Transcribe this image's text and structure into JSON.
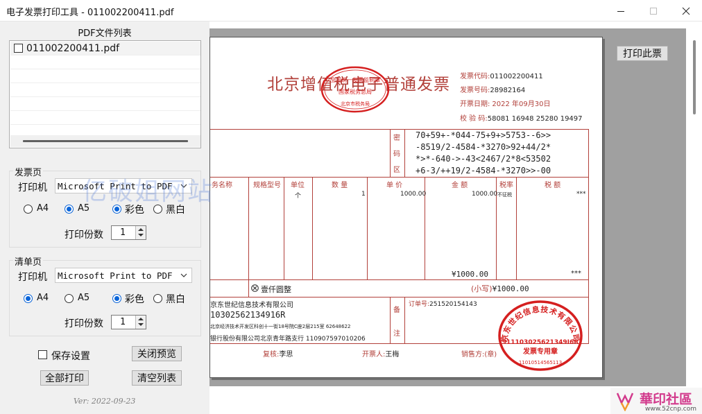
{
  "window": {
    "title": "电子发票打印工具  - 011002200411.pdf",
    "minimize_icon": "minimize-icon",
    "maximize_icon": "maximize-icon",
    "close_icon": "close-icon"
  },
  "pdf_list": {
    "title": "PDF文件列表",
    "items": [
      {
        "name": "011002200411.pdf",
        "checked": false
      }
    ]
  },
  "invoice_group": {
    "title": "发票页",
    "printer_label": "打印机",
    "printer_value": "Microsoft Print to PDF",
    "paper_options": [
      "A4",
      "A5"
    ],
    "paper_selected": "A5",
    "color_options": [
      "彩色",
      "黑白"
    ],
    "color_selected": "彩色",
    "copies_label": "打印份数",
    "copies_value": "1"
  },
  "detail_group": {
    "title": "清单页",
    "printer_label": "打印机",
    "printer_value": "Microsoft Print to PDF",
    "paper_options": [
      "A4",
      "A5"
    ],
    "paper_selected": "A4",
    "color_options": [
      "彩色",
      "黑白"
    ],
    "color_selected": "彩色",
    "copies_label": "打印份数",
    "copies_value": "1"
  },
  "actions": {
    "save_settings_label": "保存设置",
    "save_settings_checked": false,
    "close_preview_label": "关闭预览",
    "print_all_label": "全部打印",
    "clear_list_label": "清空列表",
    "print_this_label": "打印此票"
  },
  "version": "Ver: 2022-09-23",
  "watermark_text": "亿破姐网站",
  "invoice": {
    "title": "北京增值税电子普通发票",
    "code_label": "发票代码:",
    "code": "011002200411",
    "number_label": "发票号码:",
    "number": "28982164",
    "date_label": "开票日期:",
    "date": "2022 年09月30日",
    "check_label": "校 验 码:",
    "check_code": "58081 16948 25280 19497",
    "cipher_label_chars": [
      "密",
      "码",
      "区"
    ],
    "cipher_lines": [
      "70+59+-*044-75+9+>5753--6>>",
      "-8519/2-4584-*3270>92+44/2*",
      "*>*-640->-43<2467/2*8<53502",
      "+6-3/++19/2-4584-*3270>>-00"
    ],
    "headers": {
      "name": "务名称",
      "spec": "规格型号",
      "unit": "单位",
      "qty": "数 量",
      "price": "单 价",
      "amount": "金 额",
      "tax_rate": "税率",
      "tax": "税 额"
    },
    "row": {
      "unit": "个",
      "qty": "1",
      "price": "1000.00",
      "amount": "1000.00",
      "tax_rate": "不征税",
      "tax": "***"
    },
    "total_amount": "¥1000.00",
    "total_tax": "***",
    "total_words": "壹仟圆整",
    "total_small_label": "(小写)",
    "total_small": "¥1000.00",
    "seller_name": "京东世纪信息技术有限公司",
    "seller_tax_id": "10302562134916R",
    "seller_address": "北京经济技术开发区科创十一街18号院C座2层215室 62648622",
    "seller_bank": "银行股份有限公司北京青年路支行 110907597010206",
    "remark_chars": [
      "备",
      "注"
    ],
    "order_label": "订单号:",
    "order_number": "251520154143",
    "reviewer_label": "复核:",
    "reviewer": "李思",
    "drawer_label": "开票人:",
    "drawer": "王梅",
    "seller_sign_label": "销售方:(章)"
  },
  "seal_left": {
    "lines": [
      "全国统一发票监制章",
      "国家税务总局",
      "北京市税务局"
    ]
  },
  "seal_right": {
    "ring_text": "京东世纪信息技术有限公司",
    "tax_id": "911103025621349I6R",
    "caption": "发票专用章",
    "bottom_code": "11010514565113"
  },
  "brand": {
    "name": "華印社區",
    "url": "www.52cnp.com"
  },
  "colors": {
    "invoice_red": "#b2403a",
    "accent_blue": "#0a64d8",
    "preview_bg": "#a0a0a0",
    "panel_bg": "#f0f0f0"
  }
}
